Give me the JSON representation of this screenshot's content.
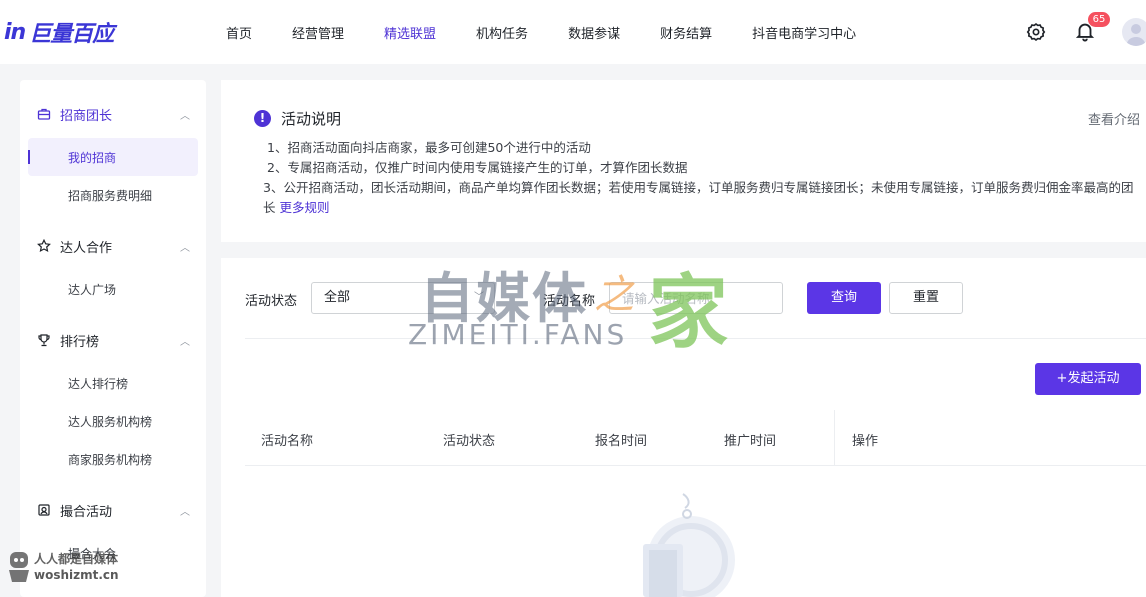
{
  "brand": {
    "mark": "in",
    "name": "巨量百应"
  },
  "nav": {
    "items": [
      "首页",
      "经营管理",
      "精选联盟",
      "机构任务",
      "数据参谋",
      "财务结算",
      "抖音电商学习中心"
    ],
    "active_index": 2,
    "notification_count": "65"
  },
  "sidebar": {
    "groups": [
      {
        "label": "招商团长",
        "icon": "briefcase-icon",
        "items": [
          "我的招商",
          "招商服务费明细"
        ]
      },
      {
        "label": "达人合作",
        "icon": "star-icon",
        "items": [
          "达人广场"
        ]
      },
      {
        "label": "排行榜",
        "icon": "trophy-icon",
        "items": [
          "达人排行榜",
          "达人服务机构榜",
          "商家服务机构榜"
        ]
      },
      {
        "label": "撮合活动",
        "icon": "calendar-icon",
        "items": [
          "撮合大会"
        ]
      }
    ],
    "active_item": "我的招商"
  },
  "info": {
    "title": "活动说明",
    "view_intro": "查看介绍",
    "rule1": "1、招商活动面向抖店商家，最多可创建50个进行中的活动",
    "rule2": "2、专属招商活动，仅推广时间内使用专属链接产生的订单，才算作团长数据",
    "rule3": "3、公开招商活动，团长活动期间，商品产单均算作团长数据；若使用专属链接，订单服务费归专属链接团长；未使用专属链接，订单服务费归佣金率最高的团长",
    "more_rules": "更多规则"
  },
  "filter": {
    "status_label": "活动状态",
    "status_value": "全部",
    "name_label": "活动名称",
    "name_placeholder": "请输入活动名称",
    "query_label": "查询",
    "reset_label": "重置"
  },
  "create_label": "+发起活动",
  "table": {
    "columns": [
      "活动名称",
      "活动状态",
      "报名时间",
      "推广时间",
      "操作"
    ]
  },
  "watermark": {
    "main_cn": "自媒体",
    "main_zhi": "之",
    "main_jia": "家",
    "main_en": "ZIMEITI.FANS",
    "corner_line1": "人人都是自媒体",
    "corner_line2": "woshizmt.cn"
  },
  "colors": {
    "accent": "#5b36e6",
    "badge": "#f5515f"
  }
}
